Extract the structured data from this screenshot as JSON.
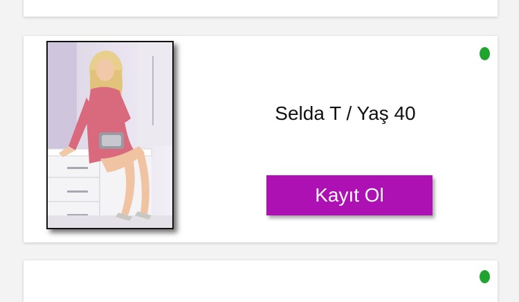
{
  "profile": {
    "name_age": "Selda T / Yaş 40",
    "online": true,
    "status_color": "#1fa52f",
    "photo_alt": "Selda T"
  },
  "register_button": {
    "label": "Kayıt Ol",
    "color": "#ad11b4"
  },
  "next_profile": {
    "online": true
  }
}
